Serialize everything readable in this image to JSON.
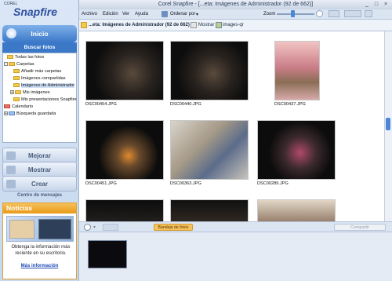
{
  "window": {
    "title": "Corel Snapfire - [...eta: Imágenes de Administrador (92 de 662)]"
  },
  "logo": {
    "corel": "COREL",
    "name": "Snapfire"
  },
  "nav": {
    "home": "Inicio",
    "find_tab": "Buscar fotos",
    "improve": "Mejorar",
    "show": "Mostrar",
    "create": "Crear",
    "messages": "Centro de mensajes"
  },
  "tree": {
    "items": [
      {
        "label": "Todas las fotos"
      },
      {
        "label": "Carpetas"
      },
      {
        "label": "Añadir más carpetas"
      },
      {
        "label": "Imágenes compartidas"
      },
      {
        "label": "Imágenes de Administrador"
      },
      {
        "label": "Mis imágenes"
      },
      {
        "label": "Mis presentaciones Snapfire"
      },
      {
        "label": "Calendario"
      },
      {
        "label": "Búsqueda guardada"
      }
    ]
  },
  "news": {
    "title": "Noticias",
    "text": "Obtenga la información más reciente en su escritorio.",
    "link": "Más información"
  },
  "menu": {
    "archivo": "Archivo",
    "edicion": "Edición",
    "ver": "Ver",
    "ayuda": "Ayuda",
    "ordenar": "Ordenar por",
    "zoom": "Zoom"
  },
  "path": {
    "text": "...eta: Imágenes de Administrador (92 de 662)",
    "mostrar": "Mostrar",
    "images_qr": "images-qr"
  },
  "photos": [
    {
      "name": "DSC00454.JPG"
    },
    {
      "name": "DSC00440.JPG"
    },
    {
      "name": "DSC00437.JPG"
    },
    {
      "name": "DSC00451.JPG"
    },
    {
      "name": "DSC00363.JPG"
    },
    {
      "name": "DSC00289.JPG"
    }
  ],
  "tray": {
    "tab": "Bandeja de fotos",
    "share": "Compartir"
  },
  "colors": {
    "accent": "#3b78c8",
    "news_header": "#e89a17"
  }
}
